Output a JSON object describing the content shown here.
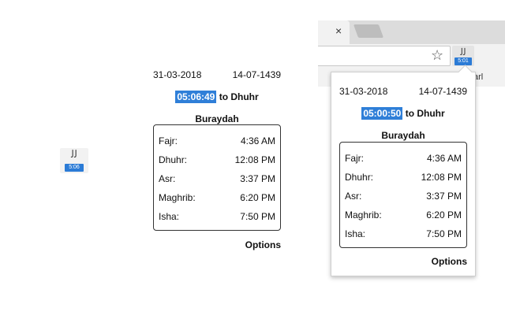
{
  "extension": {
    "icon_glyph": "ﻟﻟ",
    "left_badge": "5:06",
    "toolbar_badge": "5:01",
    "icon_name": "prayer-times-extension-icon"
  },
  "panel_left": {
    "gregorian_date": "31-03-2018",
    "hijri_date": "14-07-1439",
    "countdown": "05:06:49",
    "countdown_suffix": " to Dhuhr",
    "city": "Buraydah",
    "prayers": [
      {
        "name": "Fajr:",
        "time": "4:36 AM"
      },
      {
        "name": "Dhuhr:",
        "time": "12:08 PM"
      },
      {
        "name": "Asr:",
        "time": "3:37 PM"
      },
      {
        "name": "Maghrib:",
        "time": "6:20 PM"
      },
      {
        "name": "Isha:",
        "time": "7:50 PM"
      }
    ],
    "options_label": "Options"
  },
  "panel_popup": {
    "gregorian_date": "31-03-2018",
    "hijri_date": "14-07-1439",
    "countdown": "05:00:50",
    "countdown_suffix": " to Dhuhr",
    "city": "Buraydah",
    "prayers": [
      {
        "name": "Fajr:",
        "time": "4:36 AM"
      },
      {
        "name": "Dhuhr:",
        "time": "12:08 PM"
      },
      {
        "name": "Asr:",
        "time": "3:37 PM"
      },
      {
        "name": "Maghrib:",
        "time": "6:20 PM"
      },
      {
        "name": "Isha:",
        "time": "7:50 PM"
      }
    ],
    "options_label": "Options"
  },
  "browser": {
    "tab_close_glyph": "×",
    "star_glyph": "☆",
    "bookmark_partial": "arl"
  },
  "colors": {
    "accent": "#2f7fd8",
    "badge": "#2b7bd6"
  }
}
